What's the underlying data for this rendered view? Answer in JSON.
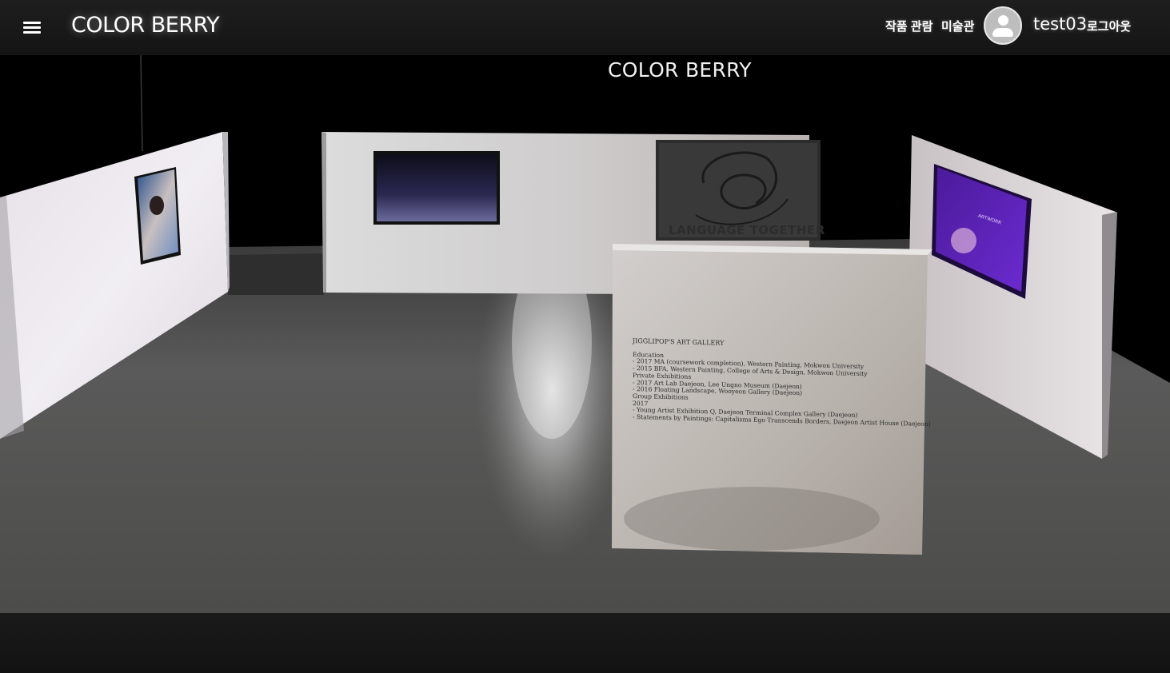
{
  "header": {
    "brand": "COLOR BERRY",
    "nav": {
      "view_artworks": "작품 관람",
      "gallery": "미술관",
      "logout": "로그아웃"
    },
    "user": {
      "name": "test03",
      "avatar_icon": "account-circle-icon"
    },
    "menu_icon": "hamburger-menu-icon"
  },
  "scene": {
    "title": "COLOR BERRY",
    "artworks": {
      "center_right_caption": "LANGUAGE TOGETHER",
      "right_wall_caption": "ARTWORK"
    },
    "info_panel": {
      "gallery_name": "JIGGLIPOP'S ART GALLERY",
      "lines": [
        "Education",
        "- 2017 MA (coursework completion), Western Painting, Mokwon University",
        "- 2015 BFA, Western Painting, College of Arts & Design, Mokwon University",
        "Private Exhibitions",
        "- 2017 Art Lab Daejeon, Lee Ungno Museum (Daejeon)",
        "- 2016 Floating Landscape, Wooyeon Gallery (Daejeon)",
        "Group Exhibitions",
        "2017",
        "- Young Artist Exhibition Q, Daejeon Terminal Complex Gallery (Daejeon)",
        "- Statements by Paintings: Capitalisms Ego Transcends Borders, Daejeon Artist House (Daejeon)"
      ]
    }
  },
  "colors": {
    "header_bg": "#1a1a1a",
    "wall": "#e6e3e6",
    "floor": "#545454",
    "violet_art": "#5a1fb0"
  }
}
